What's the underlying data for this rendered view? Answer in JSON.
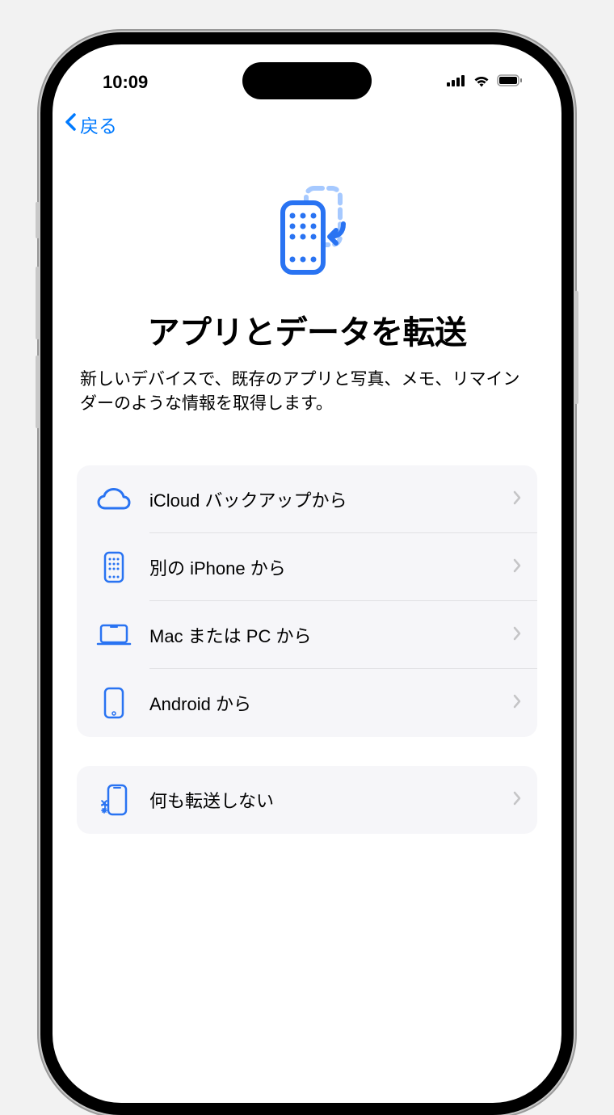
{
  "status": {
    "time": "10:09"
  },
  "nav": {
    "back_label": "戻る"
  },
  "page": {
    "title": "アプリとデータを転送",
    "subtitle": "新しいデバイスで、既存のアプリと写真、メモ、リマインダーのような情報を取得します。"
  },
  "options_a": [
    {
      "label": "iCloud バックアップから",
      "icon": "cloud"
    },
    {
      "label": "別の iPhone から",
      "icon": "phone-grid"
    },
    {
      "label": "Mac または PC から",
      "icon": "laptop"
    },
    {
      "label": "Android から",
      "icon": "phone-outline"
    }
  ],
  "options_b": [
    {
      "label": "何も転送しない",
      "icon": "phone-sparkle"
    }
  ],
  "colors": {
    "accent": "#007aff",
    "icon": "#2973f2"
  }
}
